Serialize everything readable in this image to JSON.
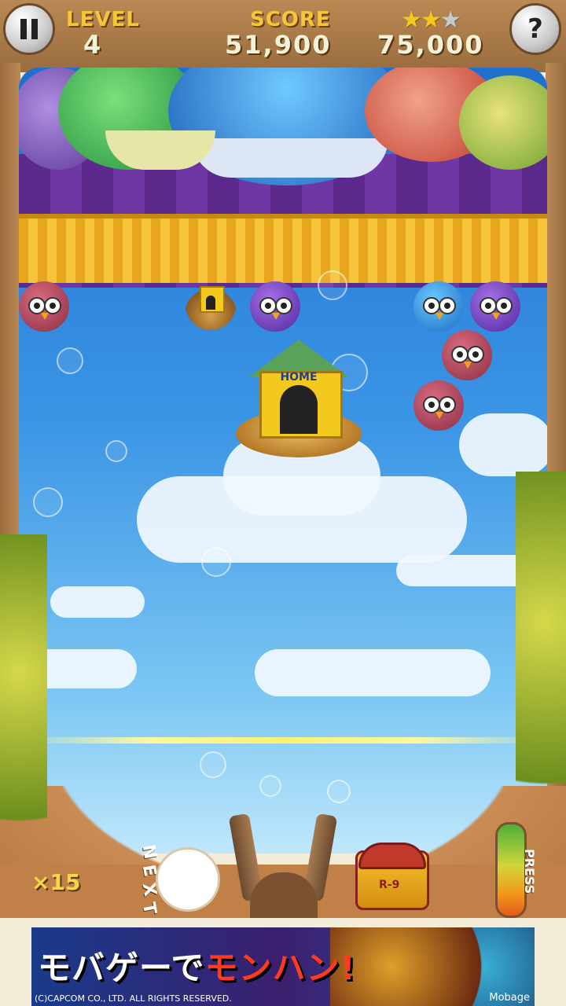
{
  "hud": {
    "level_label": "LEVEL",
    "level_value": "4",
    "score_label": "SCORE",
    "score_value": "51,900",
    "target_value": "75,000",
    "stars_earned": 2,
    "stars_total": 3
  },
  "buttons": {
    "pause_icon": "pause-icon",
    "help_label": "?"
  },
  "board": {
    "home_label": "HOME"
  },
  "launcher": {
    "next_label": "NEXT",
    "shots_remaining": "×15",
    "chest_label": "R-9",
    "meter_label": "PRESS"
  },
  "ad": {
    "text_part1": "モバゲーで",
    "text_part2": "モンハン!",
    "copyright": "(C)CAPCOM CO., LTD. ALL RIGHTS RESERVED.",
    "brand": "Mobage"
  },
  "colors": {
    "accent_gold": "#f5c635",
    "wood": "#b98a55",
    "sky": "#3b95e5"
  }
}
